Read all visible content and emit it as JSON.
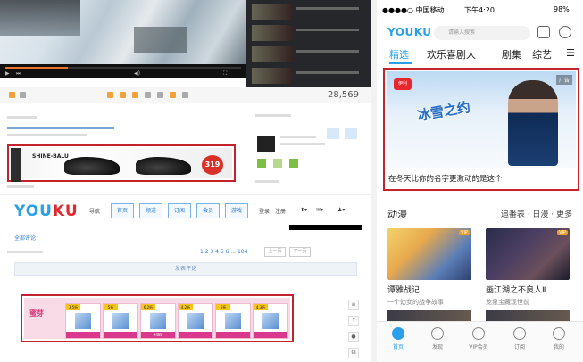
{
  "left_panel": {
    "view_count": "28,569",
    "shoe_ad": {
      "brand": "SHINE-BALU",
      "price": "319"
    },
    "youku_nav": {
      "logo_part1": "YOU",
      "logo_part2": "KU",
      "nav_label": "导航",
      "buttons": [
        "首页",
        "频道",
        "订阅",
        "会员",
        "游戏"
      ],
      "login": "登录",
      "register": "注册"
    },
    "comments_tab": "全部评论",
    "pager": {
      "pages": "1 2 3 4 5 6 ... 104",
      "prev": "上一页",
      "next": "下一页"
    },
    "comment_box": "发表评论",
    "bottom_ad": {
      "brand": "蜜芽",
      "products": [
        {
          "tag": "3.5折"
        },
        {
          "tag": "5折"
        },
        {
          "tag": "6.2折",
          "price": "¥488"
        },
        {
          "tag": "4.2折"
        },
        {
          "tag": "5折"
        },
        {
          "tag": "4.3折"
        },
        {
          "tag": "5折"
        }
      ]
    }
  },
  "phone": {
    "status": {
      "carrier": "●●●●○ 中国移动",
      "time": "下午4:20",
      "battery": "98%"
    },
    "logo": "YOUKU",
    "search_placeholder": "请输入搜索",
    "tabs": [
      "精选",
      "欢乐喜剧人",
      "剧集",
      "综艺"
    ],
    "featured": {
      "ad_tag": "广告",
      "brand_logo": "伊利",
      "slogan": "冰雪之约",
      "caption": "在冬天比你的名字更激动的是这个"
    },
    "anime": {
      "title": "动漫",
      "links": "追番表 · 日漫 · 更多",
      "cards": [
        {
          "title": "谭雅战记",
          "sub": "一个幼女的战争故事",
          "vip": "VIP"
        },
        {
          "title": "画江湖之不良人Ⅱ",
          "sub": "龙泉宝藏现世前",
          "vip": "VIP"
        }
      ]
    },
    "bottom_nav": [
      "首页",
      "发现",
      "VIP会员",
      "订阅",
      "我的"
    ]
  }
}
